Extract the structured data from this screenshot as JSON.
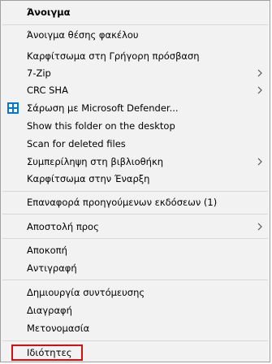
{
  "menu": {
    "items": [
      {
        "label": "Άνοιγμα"
      },
      {
        "label": "Άνοιγμα θέσης φακέλου"
      },
      {
        "label": "Καρφίτσωμα στη Γρήγορη πρόσβαση"
      },
      {
        "label": "7-Zip"
      },
      {
        "label": "CRC SHA"
      },
      {
        "label": "Σάρωση με Microsoft Defender..."
      },
      {
        "label": "Show this folder on the desktop"
      },
      {
        "label": "Scan for deleted files"
      },
      {
        "label": "Συμπερίληψη στη βιβλιοθήκη"
      },
      {
        "label": "Καρφίτσωμα στην Έναρξη"
      },
      {
        "label": "Επαναφορά προηγούμενων εκδόσεων (1)"
      },
      {
        "label": "Αποστολή προς"
      },
      {
        "label": "Αποκοπή"
      },
      {
        "label": "Αντιγραφή"
      },
      {
        "label": "Δημιουργία συντόμευσης"
      },
      {
        "label": "Διαγραφή"
      },
      {
        "label": "Μετονομασία"
      },
      {
        "label": "Ιδιότητες"
      }
    ]
  },
  "icons": {
    "defender": "shield-icon",
    "submenu": "chevron-right-icon"
  },
  "colors": {
    "menu_bg": "#f2f2f2",
    "separator": "#d7d7d7",
    "highlight_border": "#d01010",
    "defender_blue": "#0078d7"
  }
}
